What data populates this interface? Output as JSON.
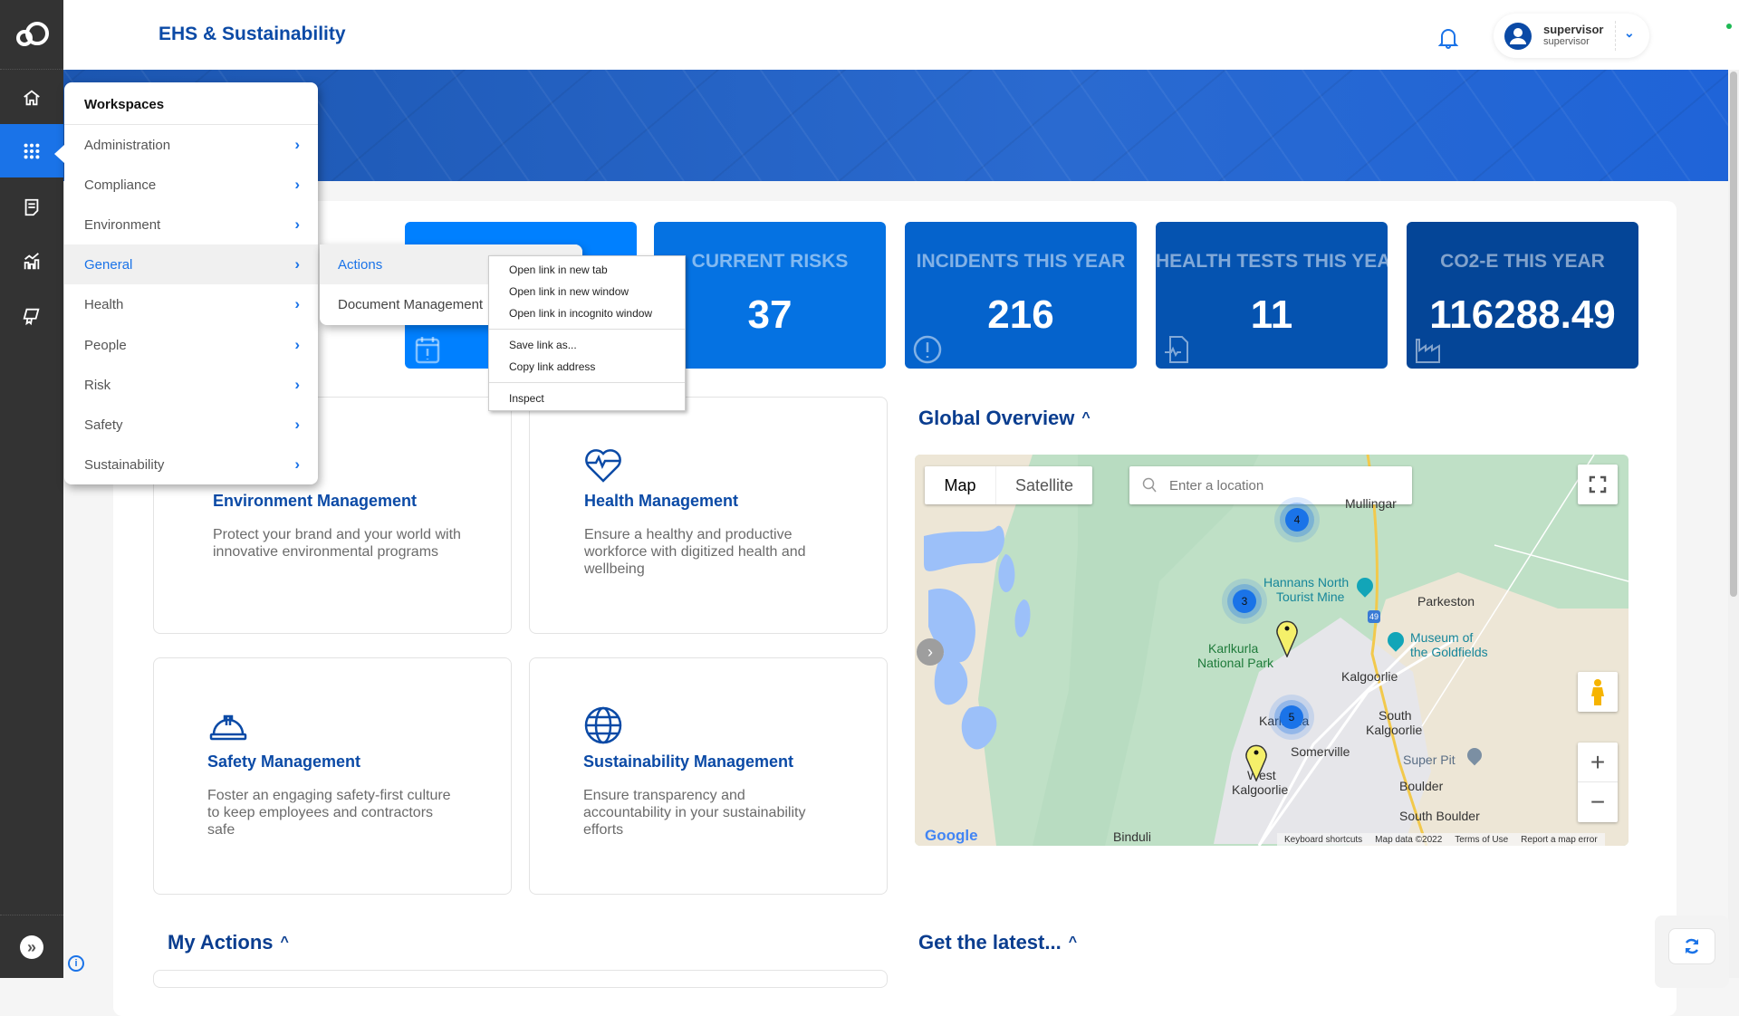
{
  "app": {
    "title": "EHS & Sustainability",
    "accent": "#1a73e8",
    "sidebar_bg": "#333333"
  },
  "sidebar": {
    "items": [
      {
        "icon": "home-icon"
      },
      {
        "icon": "apps-grid-icon",
        "active": true
      },
      {
        "icon": "document-icon"
      },
      {
        "icon": "analytics-icon"
      },
      {
        "icon": "certificate-icon"
      }
    ],
    "expand_icon": "double-chevron-right-icon"
  },
  "header": {
    "user_name": "supervisor",
    "user_role": "supervisor",
    "notification_icon": "bell-icon"
  },
  "kpis": [
    {
      "label": "",
      "value": "",
      "color": "#0080ff",
      "icon": "calendar-alert-icon"
    },
    {
      "label": "CURRENT RISKS",
      "value": "37",
      "color": "#0572e2"
    },
    {
      "label": "INCIDENTS THIS YEAR",
      "value": "216",
      "color": "#0563cc",
      "icon": "alert-circle-icon"
    },
    {
      "label": "HEALTH TESTS THIS YEAR",
      "value": "11",
      "color": "#0553b0",
      "icon": "medical-file-icon"
    },
    {
      "label": "CO2-E THIS YEAR",
      "value": "116288.49",
      "color": "#044597",
      "icon": "factory-icon"
    }
  ],
  "modules": [
    {
      "title": "Environment Management",
      "description": "Protect your brand and your world with innovative environmental programs"
    },
    {
      "title": "Health Management",
      "description": "Ensure a healthy and productive workforce with digitized health and wellbeing"
    },
    {
      "title": "Safety Management",
      "description": "Foster an engaging safety-first culture to keep employees and contractors safe"
    },
    {
      "title": "Sustainability Management",
      "description": "Ensure transparency and accountability in your sustainability efforts"
    }
  ],
  "sections": {
    "global_overview": "Global Overview",
    "my_actions": "My Actions",
    "get_latest": "Get the latest..."
  },
  "map": {
    "type_map": "Map",
    "type_satellite": "Satellite",
    "selected_type": "Map",
    "search_placeholder": "Enter a location",
    "labels": {
      "mullingar": "Mullingar",
      "hannans": "Hannans North",
      "hannans2": "Tourist Mine",
      "parkeston": "Parkeston",
      "museum": "Museum of",
      "museum2": "the Goldfields",
      "karlkurla": "Karlkurla",
      "karlkurla2": "National Park",
      "kalgoorlie": "Kalgoorlie",
      "karlkurla_suburb": "Karlkurla",
      "south_k": "South",
      "south_k2": "Kalgoorlie",
      "somerville": "Somerville",
      "superpit": "Super Pit",
      "west_k": "West",
      "west_k2": "Kalgoorlie",
      "boulder": "Boulder",
      "south_boulder": "South Boulder",
      "binduli": "Binduli",
      "route": "49"
    },
    "clusters": [
      "4",
      "3",
      "5"
    ],
    "logo": "Google",
    "footer": [
      "Keyboard shortcuts",
      "Map data ©2022",
      "Terms of Use",
      "Report a map error"
    ]
  },
  "workspaces_menu": {
    "title": "Workspaces",
    "items": [
      "Administration",
      "Compliance",
      "Environment",
      "General",
      "Health",
      "People",
      "Risk",
      "Safety",
      "Sustainability"
    ],
    "active": "General"
  },
  "submenu": {
    "items": [
      "Actions",
      "Document Management"
    ],
    "active": "Actions"
  },
  "context_menu": {
    "items": [
      "Open link in new tab",
      "Open link in new window",
      "Open link in incognito window",
      "Save link as...",
      "Copy link address",
      "Inspect"
    ]
  }
}
